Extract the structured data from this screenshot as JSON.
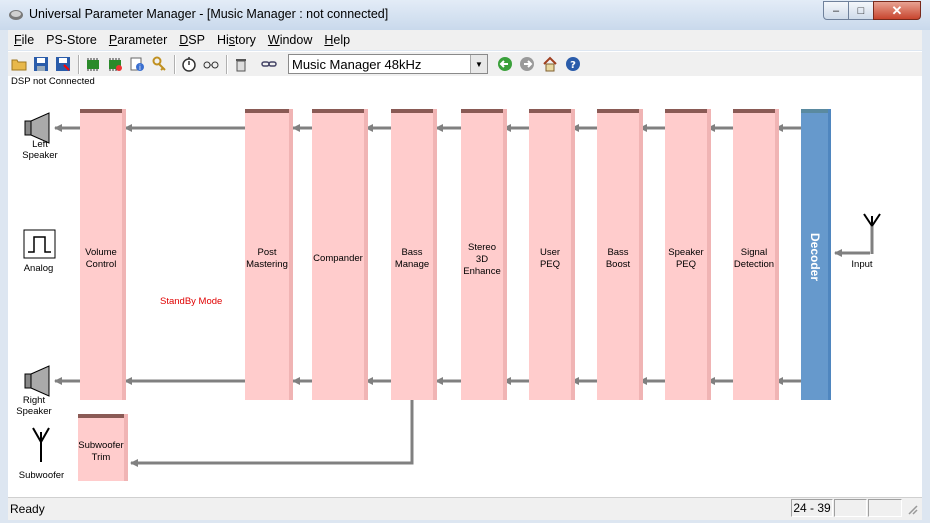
{
  "window": {
    "title": "Universal Parameter Manager - [Music Manager : not connected]",
    "minimize_glyph": "–",
    "maximize_glyph": "□",
    "close_glyph": "✕"
  },
  "menu": [
    {
      "accel": "F",
      "rest": "ile"
    },
    {
      "accel": "P",
      "rest": "S-Store"
    },
    {
      "accel": "P",
      "rest": "arameter"
    },
    {
      "accel": "D",
      "rest": "SP"
    },
    {
      "accel": "",
      "rest": "History",
      "pre": "Hi",
      "mid": "s",
      "post": "tory"
    },
    {
      "accel": "W",
      "rest": "indow"
    },
    {
      "accel": "H",
      "rest": "elp"
    }
  ],
  "toolbar": {
    "icons": [
      "open-folder-icon",
      "save-icon",
      "save-as-icon",
      "chip-read-icon",
      "chip-write-icon",
      "info-icon",
      "keys-icon",
      "stopwatch-icon",
      "glasses-icon",
      "delete-icon",
      "link-icon",
      "back-icon",
      "forward-icon",
      "home-icon",
      "help-icon"
    ],
    "preset_value": "Music Manager 48kHz"
  },
  "canvas": {
    "connection_status": "DSP not Connected",
    "standby_text": "StandBy Mode",
    "left_speaker": "Left\nSpeaker",
    "right_speaker": "Right\nSpeaker",
    "analog": "Analog",
    "subwoofer": "Subwoofer",
    "input": "Input",
    "decoder": "Decoder",
    "blocks": {
      "volume": "Volume\nControl",
      "post_mastering": "Post\nMastering",
      "compander": "Compander",
      "bass_manage": "Bass\nManage",
      "stereo_3d": "Stereo\n3D\nEnhance",
      "user_peq": "User\nPEQ",
      "bass_boost": "Bass\nBoost",
      "speaker_peq": "Speaker\nPEQ",
      "signal_detection": "Signal\nDetection",
      "subwoofer_trim": "Subwoofer\nTrim"
    }
  },
  "colors": {
    "block_fill": "#ffcccc",
    "decoder_fill": "#6699cc",
    "standby": "#e00000",
    "arrow": "#808080"
  },
  "status": {
    "text": "Ready",
    "position": "24 - 39",
    "pane2": "",
    "pane3": ""
  }
}
